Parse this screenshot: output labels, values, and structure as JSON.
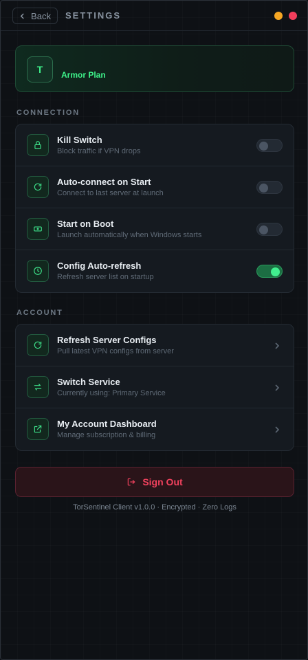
{
  "header": {
    "back_label": "Back",
    "title": "SETTINGS"
  },
  "plan": {
    "avatar_letter": "T",
    "name": "Armor Plan"
  },
  "connection": {
    "label": "CONNECTION",
    "items": [
      {
        "title": "Kill Switch",
        "subtitle": "Block traffic if VPN drops",
        "icon": "lock-icon",
        "enabled": false
      },
      {
        "title": "Auto-connect on Start",
        "subtitle": "Connect to last server at launch",
        "icon": "refresh-icon",
        "enabled": false
      },
      {
        "title": "Start on Boot",
        "subtitle": "Launch automatically when Windows starts",
        "icon": "power-box-icon",
        "enabled": false
      },
      {
        "title": "Config Auto-refresh",
        "subtitle": "Refresh server list on startup",
        "icon": "clock-icon",
        "enabled": true
      }
    ]
  },
  "account": {
    "label": "ACCOUNT",
    "items": [
      {
        "title": "Refresh Server Configs",
        "subtitle": "Pull latest VPN configs from server",
        "icon": "refresh-icon"
      },
      {
        "title": "Switch Service",
        "subtitle": "Currently using: Primary Service",
        "icon": "switch-arrows-icon"
      },
      {
        "title": "My Account Dashboard",
        "subtitle": "Manage subscription & billing",
        "icon": "external-link-icon"
      }
    ]
  },
  "signout_label": "Sign Out",
  "footer": "TorSentinel Client v1.0.0 · Encrypted · Zero Logs",
  "colors": {
    "accent": "#3ef28a",
    "danger": "#f2425e",
    "window_min": "#f5a623",
    "window_close": "#f23e5c"
  }
}
